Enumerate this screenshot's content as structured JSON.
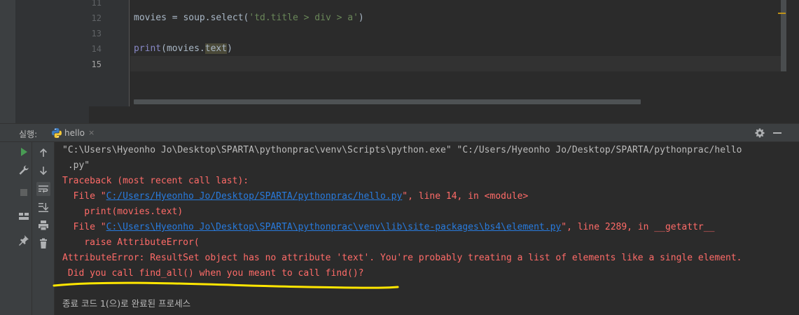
{
  "editor": {
    "line_numbers": [
      "11",
      "12",
      "13",
      "14",
      "15"
    ],
    "line12": {
      "pre": "movies = soup.select(",
      "str": "'td.title > div > a'",
      "post": ")"
    },
    "line14": {
      "builtin": "print",
      "mid": "(movies.",
      "hl": "text",
      "post": ")"
    }
  },
  "run_panel": {
    "label": "실행:",
    "tab_label": "hello",
    "tab_close": "×",
    "icons": [
      "python-icon",
      "gear-icon",
      "minimize-icon",
      "rerun-icon",
      "wrench-icon",
      "stop-icon",
      "layout-icon",
      "pin-icon",
      "up-arrow-icon",
      "down-arrow-icon",
      "soft-wrap-icon",
      "scroll-to-end-icon",
      "print-icon",
      "trash-icon"
    ]
  },
  "console": {
    "cmd1": "\"C:\\Users\\Hyeonho Jo\\Desktop\\SPARTA\\pythonprac\\venv\\Scripts\\python.exe\" \"C:/Users/Hyeonho Jo/Desktop/SPARTA/pythonprac/hello",
    "cmd2": " .py\"",
    "traceback": "Traceback (most recent call last):",
    "file1_pre": "  File \"",
    "file1_link": "C:/Users/Hyeonho Jo/Desktop/SPARTA/pythonprac/hello.py",
    "file1_post": "\", line 14, in <module>",
    "code1": "    print(movies.text)",
    "file2_pre": "  File \"",
    "file2_link": "C:\\Users\\Hyeonho Jo\\Desktop\\SPARTA\\pythonprac\\venv\\lib\\site-packages\\bs4\\element.py",
    "file2_post": "\", line 2289, in __getattr__",
    "code2": "    raise AttributeError(",
    "error1": "AttributeError: ResultSet object has no attribute 'text'. You're probably treating a list of elements like a single element.",
    "error2": " Did you call find_all() when you meant to call find()?",
    "exit": "종료 코드 1(으)로 완료된 프로세스"
  },
  "colors": {
    "background": "#2b2b2b",
    "error_text": "#ff6b68",
    "link": "#287bde",
    "annotation": "#ffe600"
  }
}
